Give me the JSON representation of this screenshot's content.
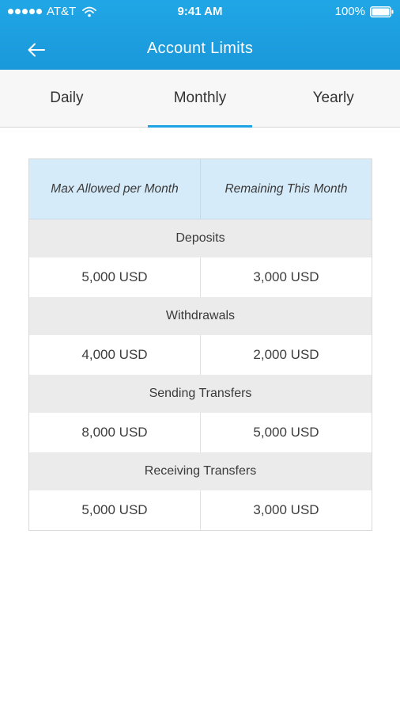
{
  "status_bar": {
    "carrier": "AT&T",
    "time": "9:41 AM",
    "battery": "100%"
  },
  "header": {
    "title": "Account Limits",
    "back_icon": "arrow-left-icon"
  },
  "tabs": [
    {
      "label": "Daily",
      "active": false
    },
    {
      "label": "Monthly",
      "active": true
    },
    {
      "label": "Yearly",
      "active": false
    }
  ],
  "table": {
    "columns": [
      "Max Allowed per Month",
      "Remaining This Month"
    ],
    "sections": [
      {
        "label": "Deposits",
        "max": "5,000 USD",
        "remaining": "3,000 USD"
      },
      {
        "label": "Withdrawals",
        "max": "4,000 USD",
        "remaining": "2,000 USD"
      },
      {
        "label": "Sending Transfers",
        "max": "8,000 USD",
        "remaining": "5,000 USD"
      },
      {
        "label": "Receiving Transfers",
        "max": "5,000 USD",
        "remaining": "3,000 USD"
      }
    ]
  },
  "colors": {
    "header": "#1a9fe0",
    "tab_indicator": "#1ea3e4",
    "table_header_bg": "#d6ebf9",
    "section_bg": "#ebebeb"
  }
}
